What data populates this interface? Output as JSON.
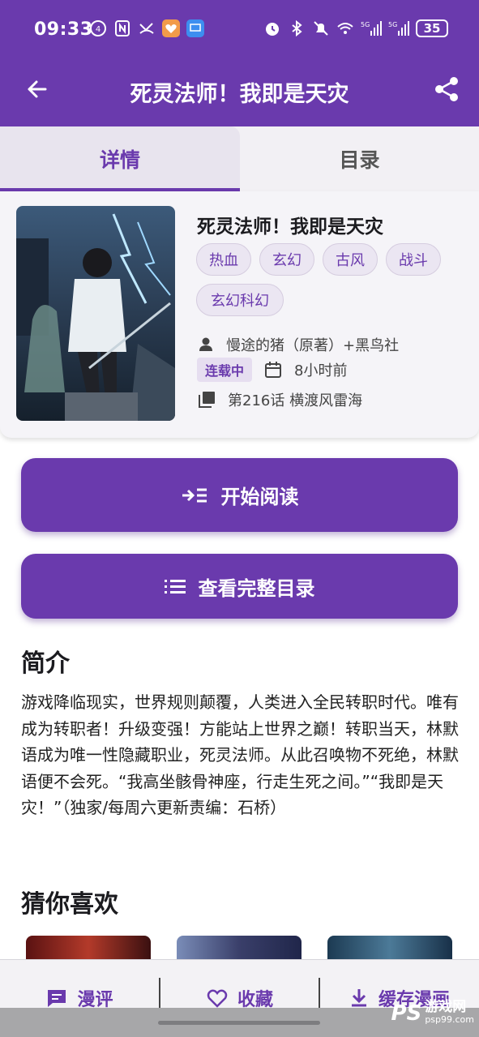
{
  "status_bar": {
    "time": "09:33",
    "battery": "35"
  },
  "app_bar": {
    "title": "死灵法师！我即是天灾"
  },
  "tabs": [
    {
      "label": "详情"
    },
    {
      "label": "目录"
    }
  ],
  "book": {
    "title": "死灵法师！我即是天灾",
    "tags": [
      "热血",
      "玄幻",
      "古风",
      "战斗",
      "玄幻科幻"
    ],
    "author": "慢途的猪（原著）+黑鸟社",
    "status": "连载中",
    "updated": "8小时前",
    "latest_chapter": "第216话 横渡风雷海"
  },
  "buttons": {
    "start_reading": "开始阅读",
    "view_catalog": "查看完整目录"
  },
  "intro": {
    "heading": "简介",
    "text": "游戏降临现实，世界规则颠覆，人类进入全民转职时代。唯有成为转职者！升级变强！方能站上世界之巅！转职当天，林默语成为唯一性隐藏职业，死灵法师。从此召唤物不死绝，林默语便不会死。“我高坐骸骨神座，行走生死之间。”“我即是天灾！”（独家/每周六更新责编：石桥）"
  },
  "recommend": {
    "heading": "猜你喜欢"
  },
  "bottom_bar": {
    "comments": "漫评",
    "favorite": "收藏",
    "cache": "缓存漫画"
  },
  "watermark": {
    "logo": "PS",
    "main": "游戏网",
    "sub": "psp99.com"
  },
  "colors": {
    "primary": "#6a3aad",
    "tag_bg": "#ebe6f2",
    "card_bg": "#f5f4f8"
  }
}
